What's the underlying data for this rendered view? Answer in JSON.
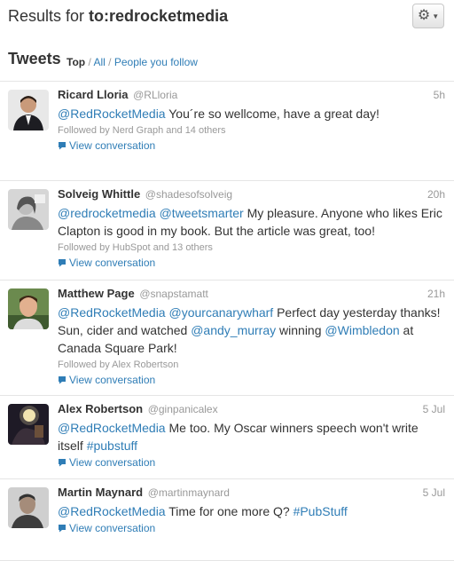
{
  "header": {
    "results_label": "Results for",
    "query": "to:redrocketmedia",
    "settings_icon": "gear-icon"
  },
  "tweets_section": {
    "title": "Tweets",
    "filters": {
      "active": "Top",
      "all": "All",
      "people_you_follow": "People you follow",
      "separator": "/"
    }
  },
  "tweets": [
    {
      "name": "Ricard Lloria",
      "handle": "@RLloria",
      "time": "5h",
      "text": [
        {
          "type": "mention",
          "text": "@RedRocketMedia"
        },
        {
          "type": "text",
          "text": " You´re so wellcome, have a great day!"
        }
      ],
      "followed_by": "Followed by Nerd Graph and 14 others",
      "view_conversation": "View conversation"
    },
    {
      "name": "Solveig Whittle",
      "handle": "@shadesofsolveig",
      "time": "20h",
      "text": [
        {
          "type": "mention",
          "text": "@redrocketmedia"
        },
        {
          "type": "text",
          "text": " "
        },
        {
          "type": "mention",
          "text": "@tweetsmarter"
        },
        {
          "type": "text",
          "text": " My pleasure. Anyone who likes Eric Clapton is good in my book. But the article was great, too!"
        }
      ],
      "followed_by": "Followed by HubSpot and 13 others",
      "view_conversation": "View conversation"
    },
    {
      "name": "Matthew Page",
      "handle": "@snapstamatt",
      "time": "21h",
      "text": [
        {
          "type": "mention",
          "text": "@RedRocketMedia"
        },
        {
          "type": "text",
          "text": " "
        },
        {
          "type": "mention",
          "text": "@yourcanarywharf"
        },
        {
          "type": "text",
          "text": " Perfect day yesterday thanks! Sun, cider and watched "
        },
        {
          "type": "mention",
          "text": "@andy_murray"
        },
        {
          "type": "text",
          "text": " winning "
        },
        {
          "type": "mention",
          "text": "@Wimbledon"
        },
        {
          "type": "text",
          "text": " at Canada Square Park!"
        }
      ],
      "followed_by": "Followed by Alex Robertson",
      "view_conversation": "View conversation"
    },
    {
      "name": "Alex Robertson",
      "handle": "@ginpanicalex",
      "time": "5 Jul",
      "text": [
        {
          "type": "mention",
          "text": "@RedRocketMedia"
        },
        {
          "type": "text",
          "text": " Me too. My Oscar winners speech won't write itself "
        },
        {
          "type": "hashtag",
          "text": "#pubstuff"
        }
      ],
      "followed_by": "",
      "view_conversation": "View conversation"
    },
    {
      "name": "Martin Maynard",
      "handle": "@martinmaynard",
      "time": "5 Jul",
      "text": [
        {
          "type": "mention",
          "text": "@RedRocketMedia"
        },
        {
          "type": "text",
          "text": " Time for one more Q? "
        },
        {
          "type": "hashtag",
          "text": "#PubStuff"
        }
      ],
      "followed_by": "",
      "view_conversation": "View conversation"
    }
  ],
  "colors": {
    "link": "#2f7db6",
    "muted": "#999999",
    "text": "#333333",
    "divider": "#e5e5e5"
  }
}
